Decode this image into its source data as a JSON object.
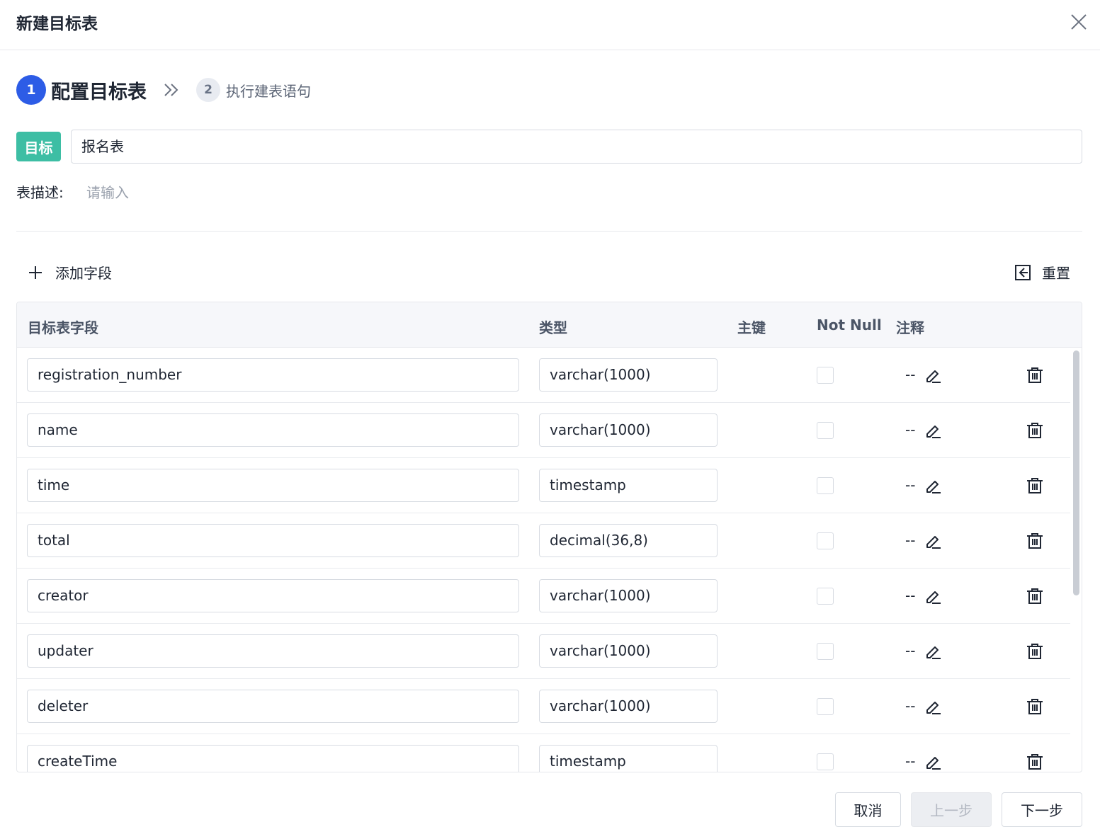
{
  "dialog": {
    "title": "新建目标表"
  },
  "steps": [
    {
      "number": "1",
      "label": "配置目标表",
      "active": true
    },
    {
      "number": "2",
      "label": "执行建表语句",
      "active": false
    }
  ],
  "target": {
    "tag": "目标",
    "value": "报名表"
  },
  "description": {
    "label": "表描述:",
    "placeholder": "请输入"
  },
  "toolbar": {
    "add_field_label": "添加字段",
    "reset_label": "重置"
  },
  "table": {
    "headers": {
      "field": "目标表字段",
      "type": "类型",
      "primary_key": "主键",
      "not_null": "Not Null",
      "comment": "注释"
    },
    "rows": [
      {
        "field": "registration_number",
        "type": "varchar(1000)",
        "comment": "--"
      },
      {
        "field": "name",
        "type": "varchar(1000)",
        "comment": "--"
      },
      {
        "field": "time",
        "type": "timestamp",
        "comment": "--"
      },
      {
        "field": "total",
        "type": "decimal(36,8)",
        "comment": "--"
      },
      {
        "field": "creator",
        "type": "varchar(1000)",
        "comment": "--"
      },
      {
        "field": "updater",
        "type": "varchar(1000)",
        "comment": "--"
      },
      {
        "field": "deleter",
        "type": "varchar(1000)",
        "comment": "--"
      },
      {
        "field": "createTime",
        "type": "timestamp",
        "comment": "--"
      }
    ]
  },
  "footer": {
    "cancel_label": "取消",
    "prev_label": "上一步",
    "next_label": "下一步"
  },
  "colors": {
    "step_active": "#2d5ce6",
    "target_tag": "#3dbea4"
  }
}
